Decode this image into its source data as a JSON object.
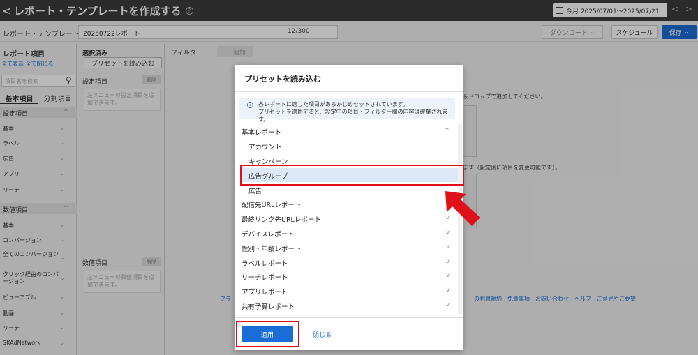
{
  "topbar": {
    "back_glyph": "<",
    "title": "レポート・テンプレートを作成する",
    "help_glyph": "?",
    "date_range": "今月 2025/07/01〜2025/07/21",
    "prev_glyph": "<",
    "next_glyph": ">"
  },
  "namerow": {
    "label": "レポート・テンプレート名",
    "value": "20250722レポート",
    "count": "12/300",
    "download": "ダウンロード",
    "schedule": "スケジュール",
    "save": "保存"
  },
  "left": {
    "title": "レポート項目",
    "show_all": "全て表示",
    "close_all": "全て閉じる",
    "search_placeholder": "項目名を検索",
    "tabs": [
      "基本項目",
      "分割項目"
    ],
    "section1": "設定項目",
    "items1": [
      "基本",
      "ラベル",
      "広告",
      "アプリ",
      "リーチ"
    ],
    "section2": "数値項目",
    "items2": [
      "基本",
      "コンバージョン",
      "全てのコンバージョン",
      "クリック経由のコンバージョン",
      "ビューアブル",
      "動画",
      "リーチ",
      "SKAdNetwork"
    ]
  },
  "mid": {
    "title": "選択済み",
    "load_button": "プリセットを読み込む",
    "settings_label": "設定項目",
    "clear": "解除",
    "settings_drop": "左メニューの設定項目を追加できます。",
    "numbers_label": "数値項目",
    "numbers_drop": "左メニューの数値項目を追加できます。"
  },
  "content": {
    "filter": "フィルター",
    "add": "＋ 追加",
    "drag_text": "＆ドロップで追加してください。",
    "note_text": "ます（設定後に項目を変更可能です）。",
    "footer_left": "プラ",
    "footer": "の利用規約 - 免責事項 - お問い合わせ - ヘルプ - ご意見やご要望"
  },
  "modal": {
    "title": "プリセットを読み込む",
    "info_line1": "各レポートに適した項目があらかじめセットされています。",
    "info_line2": "プリセットを適用すると、設定中の項目・フィルター欄の内容は破棄されます。",
    "rows": [
      {
        "label": "基本レポート",
        "level": 0,
        "chev": "^"
      },
      {
        "label": "アカウント",
        "level": 1
      },
      {
        "label": "キャンペーン",
        "level": 1
      },
      {
        "label": "広告グループ",
        "level": 1,
        "selected": true
      },
      {
        "label": "広告",
        "level": 1
      },
      {
        "label": "配信先URLレポート",
        "level": 0
      },
      {
        "label": "最終リンク先URLレポート",
        "level": 0,
        "chev": "v"
      },
      {
        "label": "デバイスレポート",
        "level": 0,
        "chev": "v"
      },
      {
        "label": "性別・年齢レポート",
        "level": 0,
        "chev": "v"
      },
      {
        "label": "ラベルレポート",
        "level": 0,
        "chev": "v"
      },
      {
        "label": "リーチレポート",
        "level": 0,
        "chev": "v"
      },
      {
        "label": "アプリレポート",
        "level": 0,
        "chev": "v"
      },
      {
        "label": "共有予算レポート",
        "level": 0,
        "chev": "v"
      }
    ],
    "apply": "適用",
    "close": "閉じる"
  },
  "colors": {
    "accent": "#1a6dd6",
    "highlight": "#e0101a",
    "selected_bg": "#dde8f8"
  }
}
